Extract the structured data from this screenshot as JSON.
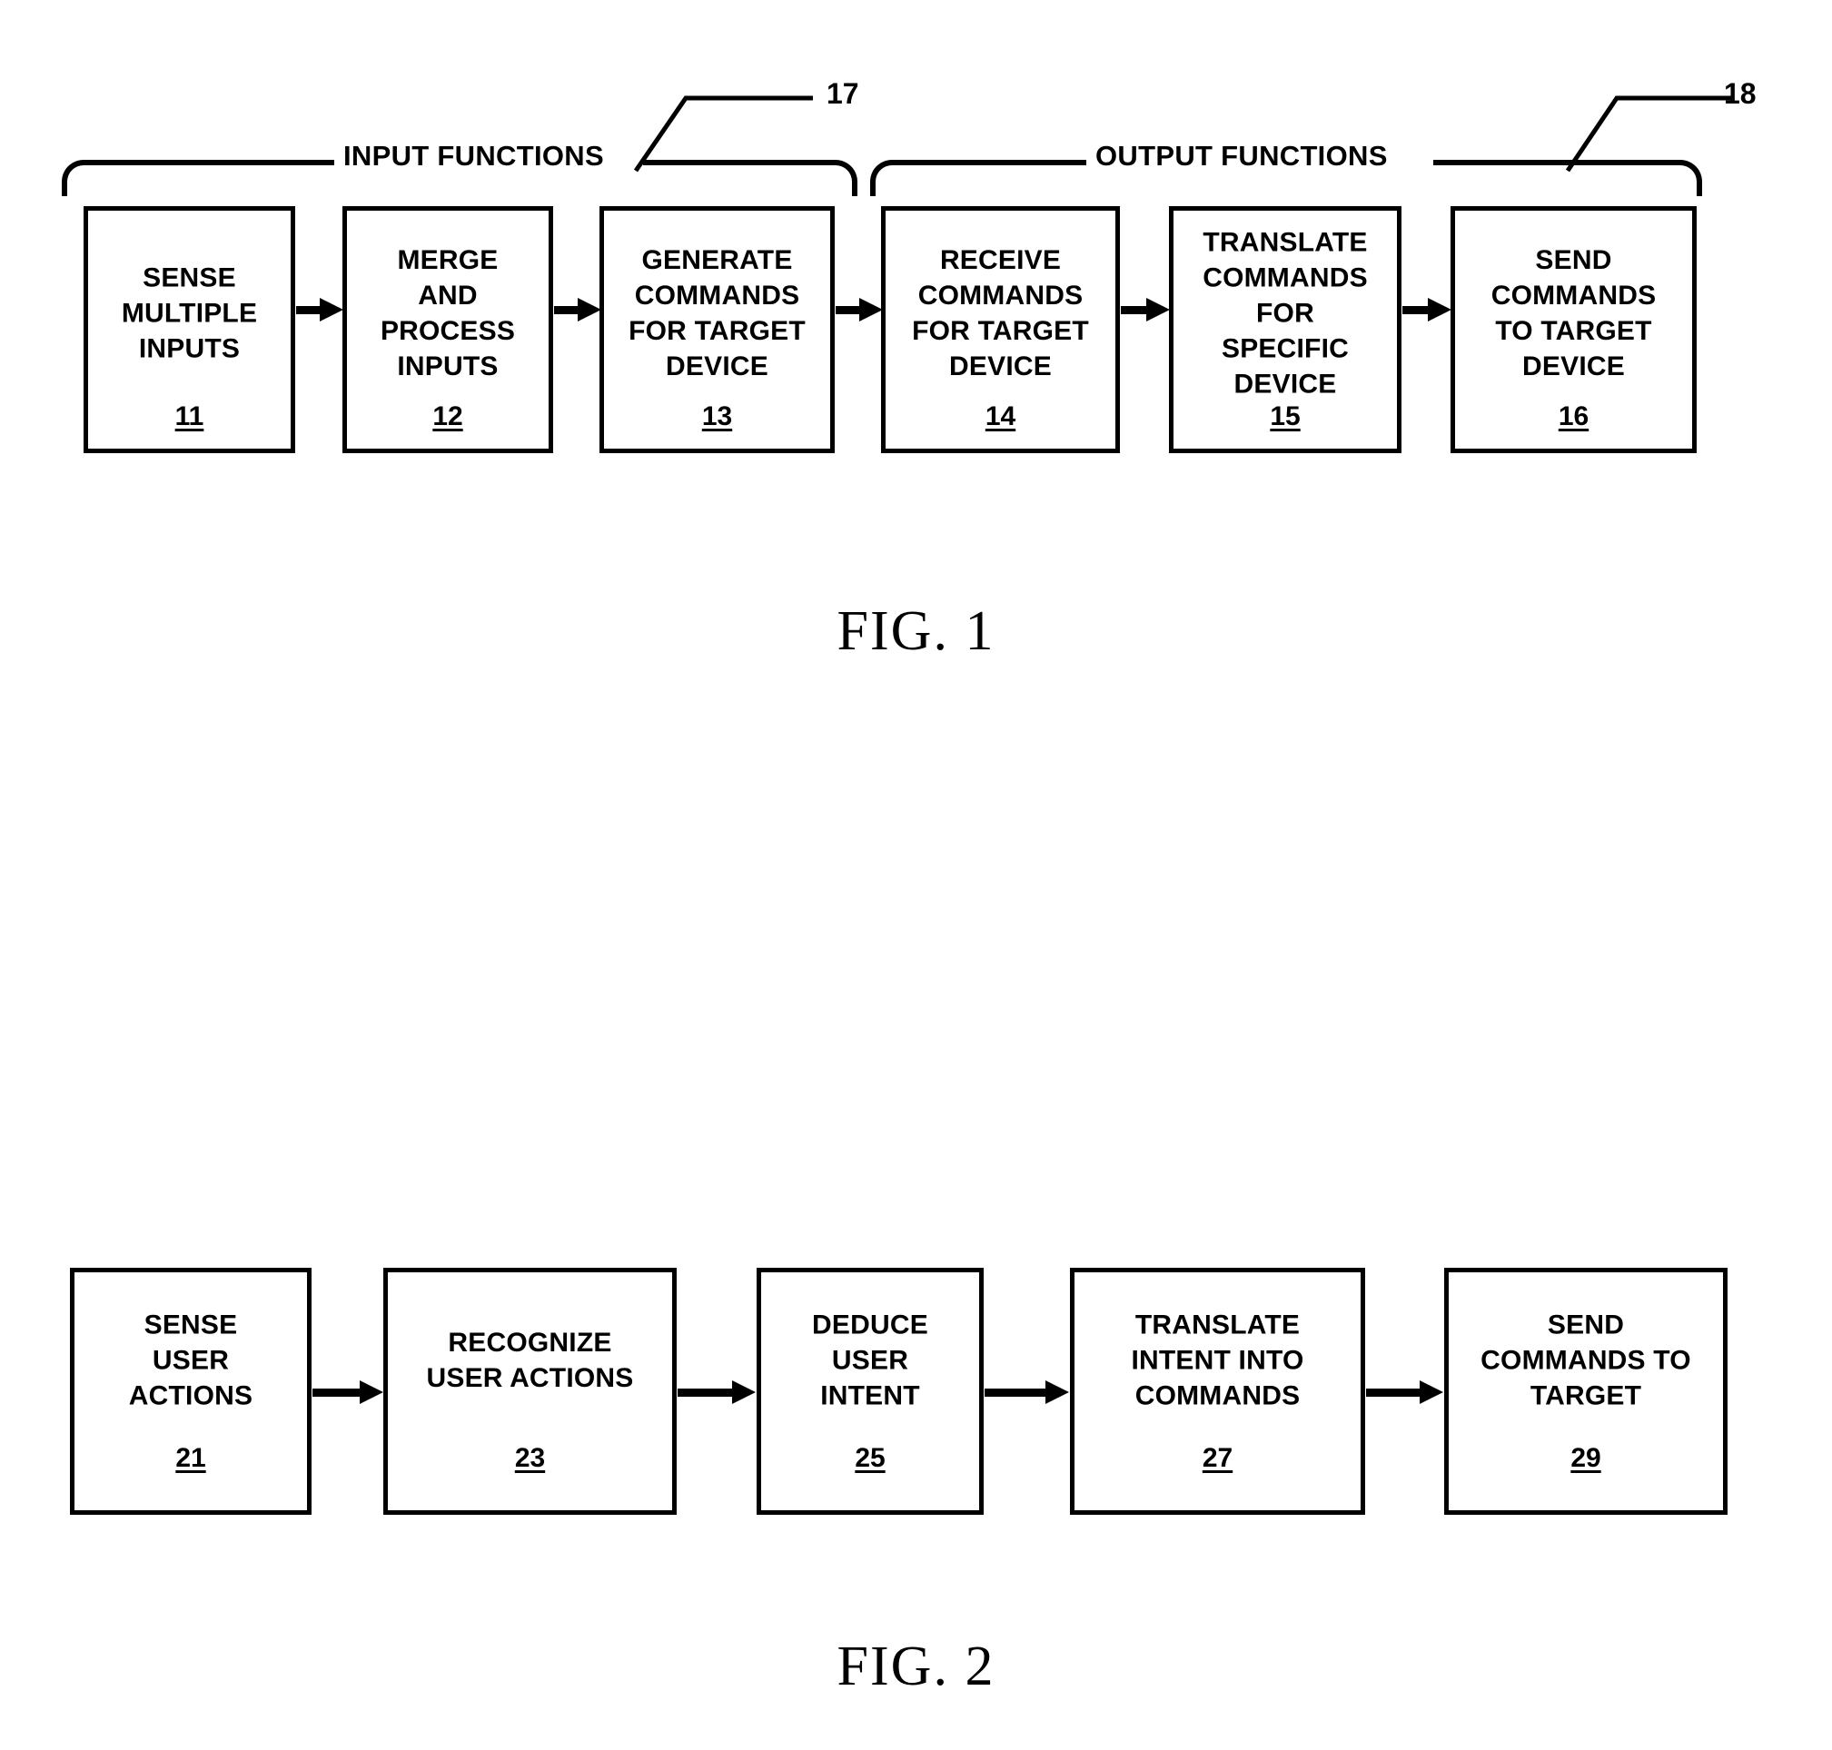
{
  "document": {
    "type": "patent-drawing-sheet"
  },
  "figure1": {
    "caption": "FIG. 1",
    "groups": [
      {
        "label": "INPUT FUNCTIONS",
        "ref": "17"
      },
      {
        "label": "OUTPUT FUNCTIONS",
        "ref": "18"
      }
    ],
    "boxes": [
      {
        "text": "SENSE\nMULTIPLE\nINPUTS",
        "ref": "11"
      },
      {
        "text": "MERGE\nAND\nPROCESS\nINPUTS",
        "ref": "12"
      },
      {
        "text": "GENERATE\nCOMMANDS\nFOR TARGET\nDEVICE",
        "ref": "13"
      },
      {
        "text": "RECEIVE\nCOMMANDS\nFOR TARGET\nDEVICE",
        "ref": "14"
      },
      {
        "text": "TRANSLATE\nCOMMANDS\nFOR\nSPECIFIC\nDEVICE",
        "ref": "15"
      },
      {
        "text": "SEND\nCOMMANDS\nTO TARGET\nDEVICE",
        "ref": "16"
      }
    ]
  },
  "figure2": {
    "caption": "FIG. 2",
    "boxes": [
      {
        "text": "SENSE\nUSER\nACTIONS",
        "ref": "21"
      },
      {
        "text": "RECOGNIZE\nUSER ACTIONS",
        "ref": "23"
      },
      {
        "text": "DEDUCE\nUSER\nINTENT",
        "ref": "25"
      },
      {
        "text": "TRANSLATE\nINTENT INTO\nCOMMANDS",
        "ref": "27"
      },
      {
        "text": "SEND\nCOMMANDS TO\nTARGET",
        "ref": "29"
      }
    ]
  },
  "colors": {
    "ink": "#000000",
    "paper": "#ffffff"
  }
}
